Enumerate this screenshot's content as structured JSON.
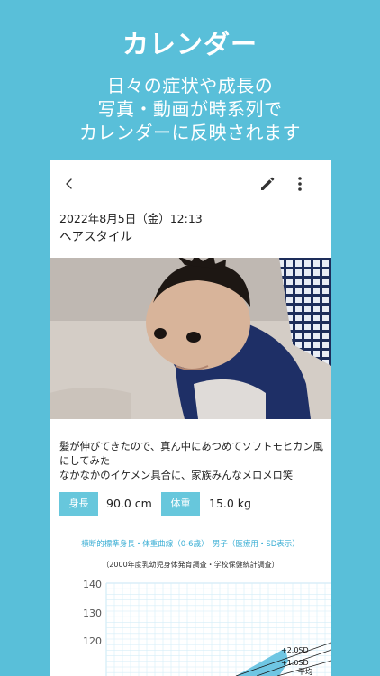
{
  "promo": {
    "title": "カレンダー",
    "subtitle_lines": [
      "日々の症状や成長の",
      "写真・動画が時系列で",
      "カレンダーに反映されます"
    ]
  },
  "toolbar": {
    "back_icon": "chevron-left-icon",
    "edit_icon": "pencil-icon",
    "more_icon": "more-vertical-icon"
  },
  "entry": {
    "date": "2022年8月5日（金）12:13",
    "title": "ヘアスタイル",
    "note_lines": [
      "髪が伸びてきたので、真ん中にあつめてソフトモヒカン風",
      "にしてみた",
      "なかなかのイケメン具合に、家族みんなメロメロ笑"
    ]
  },
  "stats": {
    "height": {
      "label": "身長",
      "value": "90.0 cm"
    },
    "weight": {
      "label": "体重",
      "value": "15.0 kg"
    }
  },
  "growth_chart": {
    "title": "横断的標準身長・体重曲線（0-6歳）　男子（医療用・SD表示）",
    "subtitle": "（2000年度乳幼児身体発育調査・学校保健統計調査）",
    "y_ticks": [
      "140",
      "130",
      "120"
    ],
    "curve_labels": [
      "+2.0SD",
      "+1.0SD",
      "平均"
    ]
  },
  "colors": {
    "background": "#59bfd9",
    "accent": "#67c7dc",
    "chart_title": "#3aaed4",
    "grid": "#d6eef8"
  }
}
